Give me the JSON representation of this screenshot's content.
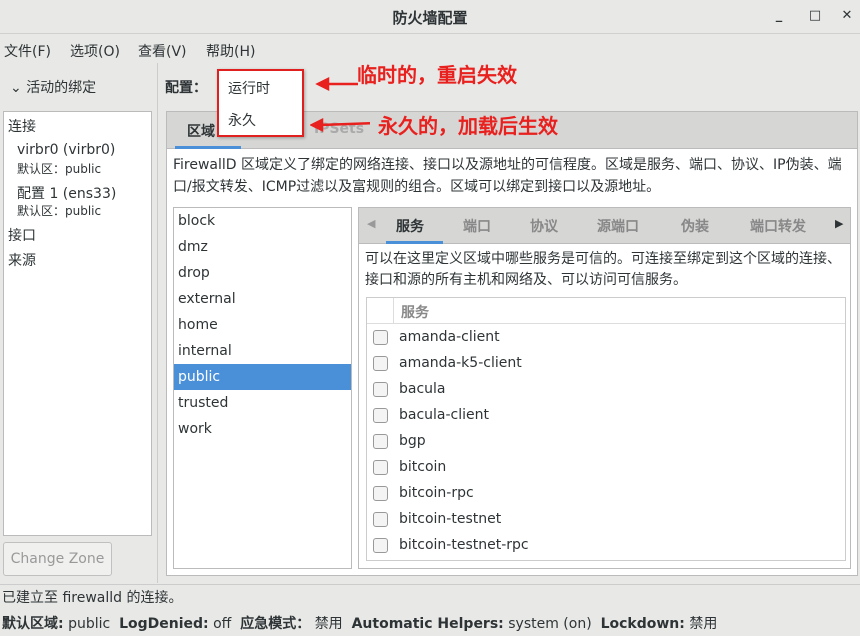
{
  "window": {
    "title": "防火墙配置",
    "minimize": "_",
    "maximize": "□",
    "close": "✕"
  },
  "menubar": [
    "文件(F)",
    "选项(O)",
    "查看(V)",
    "帮助(H)"
  ],
  "left": {
    "header": "活动的绑定",
    "items": {
      "connections": "连接",
      "conn1": "virbr0 (virbr0)",
      "conn1_zone": "默认区：public",
      "conn2": "配置 1 (ens33)",
      "conn2_zone": "默认区：public",
      "interfaces": "接口",
      "sources": "来源"
    },
    "change_zone": "Change Zone"
  },
  "config": {
    "label": "配置：",
    "options": [
      "运行时",
      "永久"
    ]
  },
  "annotations": {
    "runtime": "临时的，重启失效",
    "permanent": "永久的，加载后生效"
  },
  "tabs": {
    "zones": "区域",
    "ipsets": "IPSets"
  },
  "zones_desc": "FirewallD 区域定义了绑定的网络连接、接口以及源地址的可信程度。区域是服务、端口、协议、IP伪装、端口/报文转发、ICMP过滤以及富规则的组合。区域可以绑定到接口以及源地址。",
  "zones": [
    "block",
    "dmz",
    "drop",
    "external",
    "home",
    "internal",
    "public",
    "trusted",
    "work"
  ],
  "selected_zone": "public",
  "inner_tabs": [
    "服务",
    "端口",
    "协议",
    "源端口",
    "伪装",
    "端口转发"
  ],
  "services_desc": "可以在这里定义区域中哪些服务是可信的。可连接至绑定到这个区域的连接、接口和源的所有主机和网络及、可以访问可信服务。",
  "services_header": "服务",
  "services": [
    "amanda-client",
    "amanda-k5-client",
    "bacula",
    "bacula-client",
    "bgp",
    "bitcoin",
    "bitcoin-rpc",
    "bitcoin-testnet",
    "bitcoin-testnet-rpc"
  ],
  "status": {
    "connection": "已建立至  firewalld 的连接。",
    "default_zone_label": "默认区域:",
    "default_zone": "public",
    "logdenied_label": "LogDenied:",
    "logdenied": "off",
    "panic_label": "应急模式：",
    "panic": "禁用",
    "helpers_label": "Automatic Helpers:",
    "helpers": "system (on)",
    "lockdown_label": "Lockdown:",
    "lockdown": "禁用"
  },
  "colors": {
    "accent": "#4a90d9",
    "annotation": "#e8201e"
  }
}
